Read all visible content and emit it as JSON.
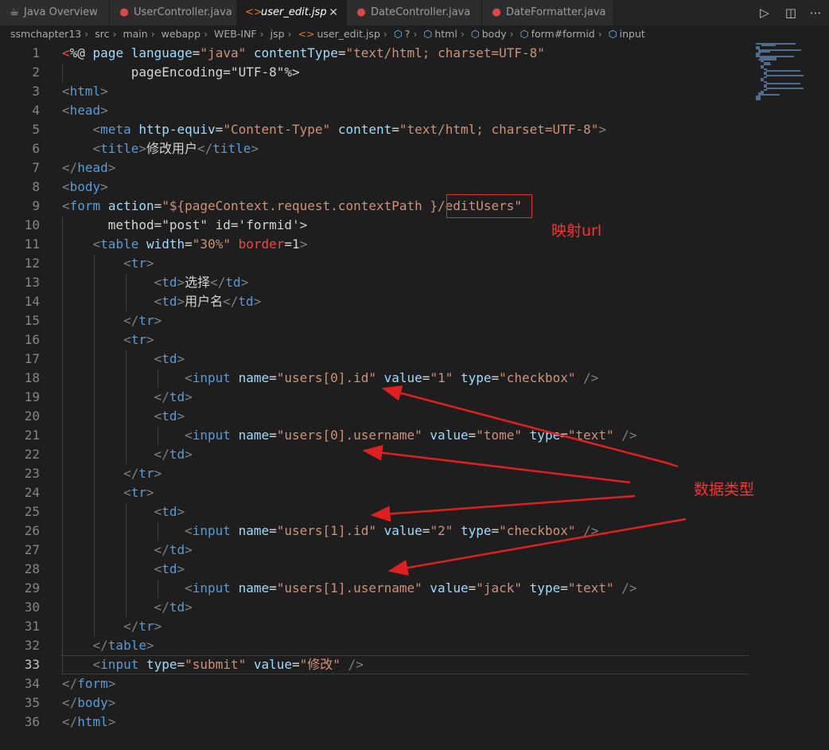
{
  "tabs": [
    {
      "label": "Java Overview",
      "icon": "java-cup-icon"
    },
    {
      "label": "UserController.java",
      "icon": "java-file-icon"
    },
    {
      "label": "user_edit.jsp",
      "icon": "code-brackets-icon",
      "active": true
    },
    {
      "label": "DateController.java",
      "icon": "java-file-icon"
    },
    {
      "label": "DateFormatter.java",
      "icon": "java-file-icon"
    }
  ],
  "toolbar": {
    "run_icon": "play-icon",
    "split_icon": "split-editor-icon",
    "more_icon": "ellipsis-icon"
  },
  "breadcrumb": [
    "ssmchapter13",
    "src",
    "main",
    "webapp",
    "WEB-INF",
    "jsp",
    "user_edit.jsp",
    "?",
    "html",
    "body",
    "form#formid",
    "input"
  ],
  "editor": {
    "line_numbers": [
      "1",
      "2",
      "3",
      "4",
      "5",
      "6",
      "7",
      "8",
      "9",
      "10",
      "11",
      "12",
      "13",
      "14",
      "15",
      "16",
      "17",
      "18",
      "19",
      "20",
      "21",
      "22",
      "23",
      "24",
      "25",
      "26",
      "27",
      "28",
      "29",
      "30",
      "31",
      "32",
      "33",
      "34",
      "35",
      "36"
    ],
    "lines": [
      "<%@ page language=\"java\" contentType=\"text/html; charset=UTF-8\"",
      "         pageEncoding=\"UTF-8\"%>",
      "<html>",
      "<head>",
      "    <meta http-equiv=\"Content-Type\" content=\"text/html; charset=UTF-8\">",
      "    <title>修改用户</title>",
      "</head>",
      "<body>",
      "<form action=\"${pageContext.request.contextPath }/editUsers\"",
      "      method=\"post\" id='formid'>",
      "    <table width=\"30%\" border=1>",
      "        <tr>",
      "            <td>选择</td>",
      "            <td>用户名</td>",
      "        </tr>",
      "        <tr>",
      "            <td>",
      "                <input name=\"users[0].id\" value=\"1\" type=\"checkbox\" />",
      "            </td>",
      "            <td>",
      "                <input name=\"users[0].username\" value=\"tome\" type=\"text\" />",
      "            </td>",
      "        </tr>",
      "        <tr>",
      "            <td>",
      "                <input name=\"users[1].id\" value=\"2\" type=\"checkbox\" />",
      "            </td>",
      "            <td>",
      "                <input name=\"users[1].username\" value=\"jack\" type=\"text\" />",
      "            </td>",
      "        </tr>",
      "    </table>",
      "    <input type=\"submit\" value=\"修改\" />",
      "</form>",
      "</body>",
      "</html>"
    ]
  },
  "annotations": {
    "mapping_url": "映射url",
    "data_type": "数据类型"
  },
  "colors": {
    "tag": "#569cd6",
    "attr": "#9cdcfe",
    "string": "#ce9178",
    "punct": "#808080",
    "annotation": "#ff3030"
  }
}
